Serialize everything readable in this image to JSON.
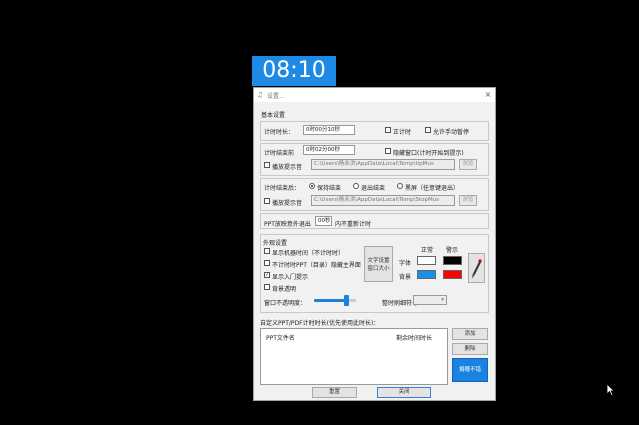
{
  "timer": {
    "display": "08:10"
  },
  "window": {
    "title": "设置...",
    "close_glyph": "×"
  },
  "basic": {
    "group_label": "基本设置",
    "duration_label": "计时时长：",
    "duration_value": "0时00分10秒",
    "countup_label": "正计时",
    "allow_manual_pause_label": "允许手动暂停",
    "end_before_label": "计时结束前",
    "end_before_value": "0时02分00秒",
    "hide_window_label": "隐藏窗口(计时开始到提示)",
    "play_sound_label": "播放提示音",
    "sound_path_1": "C:\\Users\\杨永洪\\AppData\\Local\\Temp\\tipMus",
    "browse_label": "浏览",
    "after_end_label": "计时结束后：",
    "opt_keep": "保持结束",
    "opt_exit": "退出结束",
    "opt_black": "黑屏（任意键退出）",
    "sound_path_2": "C:\\Users\\杨永洪\\AppData\\Local\\Temp\\StopMus",
    "ppt_exit_label": "PPT放映意外退出",
    "ppt_exit_value": "00秒",
    "ppt_exit_suffix": "内不重新计时"
  },
  "advanced": {
    "group_label": "外观设置",
    "show_machine_time": "显示机器时间（不计时时）",
    "hide_main_when_not_timing": "不计时时PPT（目录）隐藏主界面",
    "show_entry_tip": "显示入门提示",
    "transparent_bg": "背景透明",
    "text_to_size_btn": "文字设置\n窗口大小",
    "col_normal": "正常",
    "col_warn": "警示",
    "row_font": "字体",
    "row_bg": "背景",
    "opacity_label": "窗口不透明度：",
    "opacity_value": 0.8,
    "time_separator_label": "整时刷细符号：",
    "time_separator_value": ""
  },
  "custom": {
    "group_label": "自定义PPT/PDF计时时长(优先使用此时长)：",
    "col_file": "PPT文件名",
    "col_duration": "剩余时间时长",
    "add_btn": "添加",
    "delete_btn": "删除",
    "donate_btn": "捐赠不错"
  },
  "footer": {
    "reset_btn": "重置",
    "close_btn": "关闭"
  },
  "colors": {
    "timer_bg": "#1e8ae6",
    "font_normal": "#ffffff",
    "font_warn": "#000000",
    "bg_normal": "#1a8fe8",
    "bg_warn": "#ff0000",
    "donate_bg": "#1a82e0"
  }
}
